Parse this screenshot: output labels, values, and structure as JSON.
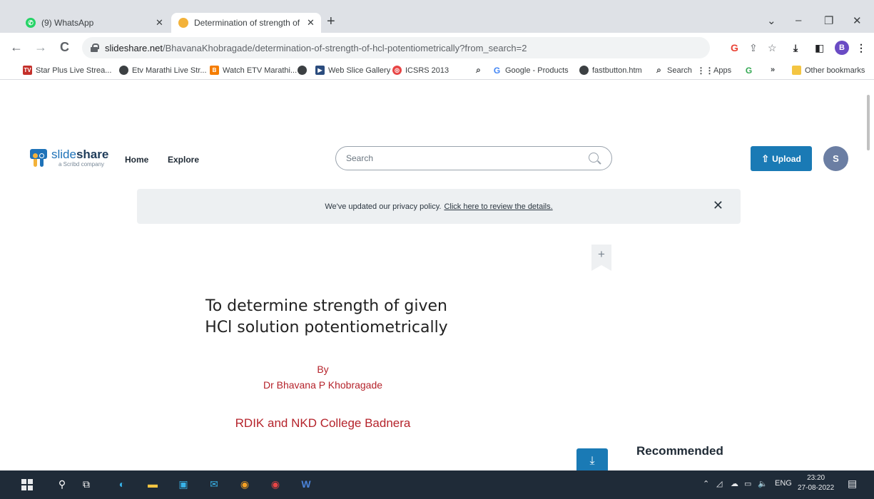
{
  "browser": {
    "tabs": [
      {
        "title": "(9) WhatsApp",
        "favicon": "whatsapp-icon",
        "active": false
      },
      {
        "title": "Determination of strength of HCl",
        "favicon": "slideshare-icon",
        "active": true
      }
    ],
    "new_tab": "+",
    "window_controls": {
      "chevron": "⌄",
      "minimize": "–",
      "restore": "❐",
      "close": "✕"
    },
    "address": {
      "domain": "slideshare.net",
      "path": "/BhavanaKhobragade/determination-of-strength-of-hcl-potentiometrically?from_search=2"
    },
    "profile_initial": "B",
    "bookmarks": [
      {
        "label": "Star Plus Live Strea...",
        "icon": "tv-icon"
      },
      {
        "label": "Etv Marathi Live Str...",
        "icon": "globe-icon"
      },
      {
        "label": "Watch ETV Marathi...",
        "icon": "blogger-icon"
      },
      {
        "label": "",
        "icon": "globe-icon"
      },
      {
        "label": "Web Slice Gallery",
        "icon": "webslice-icon"
      },
      {
        "label": "ICSRS 2013",
        "icon": "target-icon"
      },
      {
        "label": "",
        "icon": "search-icon"
      },
      {
        "label": "Google - Products",
        "icon": "google-icon"
      },
      {
        "label": "fastbutton.htm",
        "icon": "globe-icon"
      },
      {
        "label": "Search",
        "icon": "search-icon"
      },
      {
        "label": "Apps",
        "icon": "apps-grid-icon"
      },
      {
        "label": "",
        "icon": "google-icon"
      }
    ],
    "bookmarks_overflow": "»",
    "other_bookmarks": "Other bookmarks"
  },
  "site": {
    "logo_slide": "slide",
    "logo_share": "share",
    "logo_tagline": "a Scribd company",
    "nav": {
      "home": "Home",
      "explore": "Explore"
    },
    "search_placeholder": "Search",
    "upload_label": "Upload",
    "avatar_initial": "S",
    "notice": {
      "text": "We've updated our privacy policy.",
      "link": "Click here to review the details.",
      "close": "✕"
    }
  },
  "slide": {
    "title_line1": "To determine strength of given",
    "title_line2": "HCl solution potentiometrically",
    "by": "By",
    "author": "Dr Bhavana P Khobragade",
    "college": "RDIK and NKD College Badnera"
  },
  "recommended": "Recommended",
  "taskbar": {
    "tray_text": "ENG",
    "time": "23:20",
    "date": "27-08-2022"
  },
  "colors": {
    "slideshare_blue": "#1a7ab5",
    "slide_red": "#b5232b",
    "taskbar": "#1f2b38"
  }
}
